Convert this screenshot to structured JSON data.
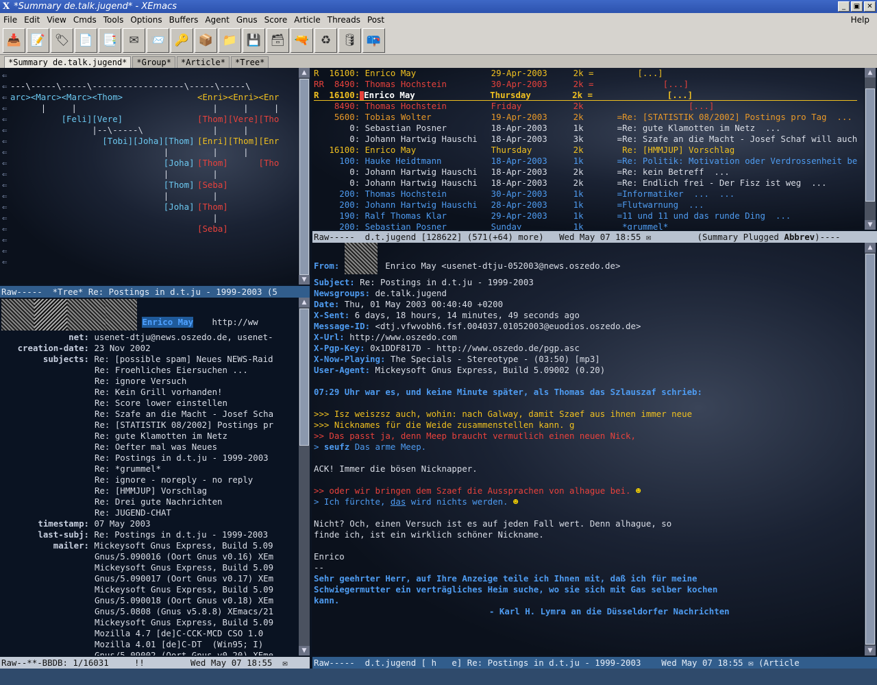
{
  "window": {
    "logo": "X",
    "title": "*Summary de.talk.jugend* - XEmacs",
    "buttons": [
      "_",
      "▣",
      "✕"
    ]
  },
  "menu": [
    "File",
    "Edit",
    "View",
    "Cmds",
    "Tools",
    "Options",
    "Buffers",
    "Agent",
    "Gnus",
    "Score",
    "Article",
    "Threads",
    "Post"
  ],
  "menu_help": "Help",
  "toolbar_icons": [
    "inbox-icon",
    "write-icon",
    "tag-icon",
    "document-icon",
    "forward-icon",
    "mail-icon",
    "mail-reply-icon",
    "key-icon",
    "package-icon",
    "folder-icon",
    "save-icon",
    "box-icon",
    "gun-icon",
    "recycle-icon",
    "barrel-icon",
    "mailbox-icon"
  ],
  "tabs": [
    "*Summary de.talk.jugend*",
    "*Group*",
    "*Article*",
    "*Tree*"
  ],
  "tree": {
    "lines": [
      "---\\-----\\-----\\------------------\\-----\\-----\\",
      "arc><Marc><Marc><Thom>",
      "      |     |",
      "          [Feli][Vere]",
      "                |--\\-----\\",
      "                  [Tobi][Joha][Thom]",
      "                              |",
      "                              [Joha]",
      "                              |",
      "                              [Thom]",
      "                              |",
      "                              [Joha]"
    ],
    "red_lines": [
      "<Enri><Enri><Enr",
      "   |     |     |",
      "[Thom][Vere][Tho",
      "   |     |",
      "[Enri][Thom][Enr",
      "   |     |",
      "[Thom]      [Tho",
      "   |",
      "[Seba]",
      "   |",
      "[Thom]",
      "   |",
      "[Seba]"
    ],
    "modeline": "Raw-----  *Tree* Re: Postings in d.t.ju - 1999-2003 (5"
  },
  "summary": {
    "rows": [
      {
        "mark": "R ",
        "num": "16100:",
        "from": "Enrico May",
        "date": "29-Apr-2003",
        "size": "2k =",
        "subject": "    [...]",
        "cls": "c-y"
      },
      {
        "mark": "RR",
        "num": " 8490:",
        "from": "Thomas Hochstein",
        "date": "30-Apr-2003",
        "size": "2k =",
        "subject": "         [...]",
        "cls": "c-r"
      },
      {
        "mark": "R ",
        "num": "16100:",
        "from": "Enrico May",
        "date": "Thursday",
        "size": "2k =",
        "subject": "          [...]",
        "cls": "c-y"
      },
      {
        "mark": "  ",
        "num": " 8490:",
        "from": "Thomas Hochstein",
        "date": "Friday",
        "size": "2k",
        "subject": "              [...]",
        "cls": "c-r"
      },
      {
        "mark": "  ",
        "num": " 5600:",
        "from": "Tobias Wolter",
        "date": "19-Apr-2003",
        "size": "2k",
        "subject": "=Re: [STATISTIK 08/2002] Postings pro Tag  ...",
        "cls": "c-o"
      },
      {
        "mark": "  ",
        "num": "    0:",
        "from": "Sebastian Posner",
        "date": "18-Apr-2003",
        "size": "1k",
        "subject": "=Re: gute Klamotten im Netz  ...",
        "cls": "c-w"
      },
      {
        "mark": "  ",
        "num": "    0:",
        "from": "Johann Hartwig Hauschi",
        "date": "18-Apr-2003",
        "size": "3k",
        "subject": "=Re: Szafe an die Macht - Josef Schaf will auch",
        "cls": "c-w"
      },
      {
        "mark": "  ",
        "num": "16100:",
        "from": "Enrico May",
        "date": "Thursday",
        "size": "2k",
        "subject": " Re: [HMMJUP] Vorschlag",
        "cls": "c-y"
      },
      {
        "mark": "  ",
        "num": "  100:",
        "from": "Hauke Heidtmann",
        "date": "18-Apr-2003",
        "size": "1k",
        "subject": "=Re: Politik: Motivation oder Verdrossenheit be",
        "cls": "c-b"
      },
      {
        "mark": "  ",
        "num": "    0:",
        "from": "Johann Hartwig Hauschi",
        "date": "18-Apr-2003",
        "size": "2k",
        "subject": "=Re: kein Betreff  ...",
        "cls": "c-w"
      },
      {
        "mark": "  ",
        "num": "    0:",
        "from": "Johann Hartwig Hauschi",
        "date": "18-Apr-2003",
        "size": "2k",
        "subject": "=Re: Endlich frei - Der Fisz ist weg  ...",
        "cls": "c-w"
      },
      {
        "mark": "  ",
        "num": "  200:",
        "from": "Thomas Hochstein",
        "date": "30-Apr-2003",
        "size": "1k",
        "subject": "=Informatiker  ...  ...",
        "cls": "c-b"
      },
      {
        "mark": "  ",
        "num": "  200:",
        "from": "Johann Hartwig Hauschi",
        "date": "28-Apr-2003",
        "size": "1k",
        "subject": "=Flutwarnung  ...",
        "cls": "c-b"
      },
      {
        "mark": "  ",
        "num": "  190:",
        "from": "Ralf Thomas Klar",
        "date": "29-Apr-2003",
        "size": "1k",
        "subject": "=11 und 11 und das runde Ding  ...",
        "cls": "c-b"
      },
      {
        "mark": "  ",
        "num": "  200:",
        "from": "Sebastian Posner",
        "date": "Sunday",
        "size": "1k",
        "subject": " *grummel*",
        "cls": "c-b"
      }
    ],
    "modeline_left": "Raw-----  d.t.jugend [128622] (571(+64) more)",
    "modeline_mid": "Wed May 07 18:55",
    "modeline_right": "(Summary Plugged ",
    "modeline_bold": "Abbrev",
    "modeline_tail": ")----"
  },
  "bbdb": {
    "name": "Enrico May",
    "url": "http://ww",
    "fields": [
      {
        "label": "net:",
        "value": "usenet-dtju@news.oszedo.de, usenet-"
      },
      {
        "label": "creation-date:",
        "value": "23 Nov 2002"
      },
      {
        "label": "subjects:",
        "value": "Re: [possible spam] Neues NEWS-Raid"
      }
    ],
    "subjects": [
      "Re: Froehliches Eiersuchen ...",
      "Re: ignore Versuch",
      "Re: Kein Grill vorhanden!",
      "Re: Score lower einstellen",
      "Re: Szafe an die Macht - Josef Scha",
      "Re: [STATISTIK 08/2002] Postings pr",
      "Re: gute Klamotten im Netz",
      "Re: Oefter mal was Neues",
      "Re: Postings in d.t.ju - 1999-2003",
      "Re: *grummel*",
      "Re: ignore - noreply - no reply",
      "Re: [HMMJUP] Vorschlag",
      "Re: Drei gute Nachrichten",
      "Re: JUGEND-CHAT"
    ],
    "fields2": [
      {
        "label": "timestamp:",
        "value": "07 May 2003"
      },
      {
        "label": "last-subj:",
        "value": "Re: Postings in d.t.ju - 1999-2003"
      },
      {
        "label": "mailer:",
        "value": "Mickeysoft Gnus Express, Build 5.09"
      }
    ],
    "mailers": [
      "Gnus/5.090016 (Oort Gnus v0.16) XEm",
      "Mickeysoft Gnus Express, Build 5.09",
      "Gnus/5.090017 (Oort Gnus v0.17) XEm",
      "Mickeysoft Gnus Express, Build 5.09",
      "Gnus/5.090018 (Oort Gnus v0.18) XEm",
      "Gnus/5.0808 (Gnus v5.8.8) XEmacs/21",
      "Mickeysoft Gnus Express, Build 5.09",
      "Mozilla 4.7 [de]C-CCK-MCD CSO 1.0",
      "Mozilla 4.01 [de]C-DT  (Win95; I)",
      "Gnus/5.09002 (Oort Gnus v0.20) XEme"
    ],
    "modeline_left": "Raw--**-BBDB: 1/16031     !!",
    "modeline_mid": "Wed May 07 18:55"
  },
  "article": {
    "from_label": "From:",
    "from": "Enrico May <usenet-dtju-052003@news.oszedo.de>",
    "headers": [
      {
        "k": "Subject:",
        "v": "Re: Postings in d.t.ju - 1999-2003"
      },
      {
        "k": "Newsgroups:",
        "v": "de.talk.jugend"
      },
      {
        "k": "Date:",
        "v": "Thu, 01 May 2003 00:40:40 +0200"
      },
      {
        "k": "X-Sent:",
        "v": "6 days, 18 hours, 14 minutes, 49 seconds ago"
      },
      {
        "k": "Message-ID:",
        "v": "<dtj.vfwvobh6.fsf.004037.01052003@euodios.oszedo.de>"
      },
      {
        "k": "X-Url:",
        "v": "http://www.oszedo.com"
      },
      {
        "k": "X-Pgp-Key:",
        "v": "0x1DDF817D - http://www.oszedo.de/pgp.asc"
      },
      {
        "k": "X-Now-Playing:",
        "v": "The Specials - Stereotype - (03:50) [mp3]"
      },
      {
        "k": "User-Agent:",
        "v": "Mickeysoft Gnus Express, Build 5.09002 (0.20)"
      }
    ],
    "attribution": "07:29 Uhr war es, und keine Minute später, als Thomas das Szlauszaf schrieb:",
    "quote3a": ">>> Isz weiszsz auch, wohin: nach Galway, damit Szaef aus ihnen immer neue",
    "quote3b": ">>> Nicknames für die Weide zusammenstellen kann. g",
    "quote2a": ">> Das passt ja, denn Meep braucht vermutlich einen neuen Nick,",
    "quote1a_pre": "> ",
    "quote1a_bold": "seufz",
    "quote1a_post": " Das arme Meep.",
    "body1": "ACK! Immer die bösen Nicknapper.",
    "quote2b": ">> oder wir bringen dem Szaef die Aussprachen von alhague bei.",
    "quote1b_pre": "> Ich fürchte, ",
    "quote1b_link": "das",
    "quote1b_post": " wird nichts werden.",
    "body2a": "Nicht? Och, einen Versuch ist es auf jeden Fall wert. Denn alhague, so",
    "body2b": "finde ich, ist ein wirklich schöner Nickname.",
    "sig_name": "Enrico",
    "sig_sep": "--",
    "sig1": "Sehr geehrter Herr, auf Ihre Anzeige teile ich Ihnen mit, daß ich für meine",
    "sig2": "Schwiegermutter ein verträgliches Heim suche, wo sie sich mit Gas selber kochen",
    "sig3": "kann.",
    "sig4": "- Karl H. Lymra an die Düsseldorfer Nachrichten",
    "modeline_left": "Raw-----  d.t.jugend [ h   e] Re: Postings in d.t.ju - 1999-2003",
    "modeline_mid": "Wed May 07 18:55",
    "modeline_right": "(Article"
  },
  "colors": {
    "modeline_blue": "#315d8c",
    "pane_bg": "#0b1422",
    "yellow": "#f0c020",
    "red": "#e8423c",
    "blue": "#4e9bf0"
  }
}
